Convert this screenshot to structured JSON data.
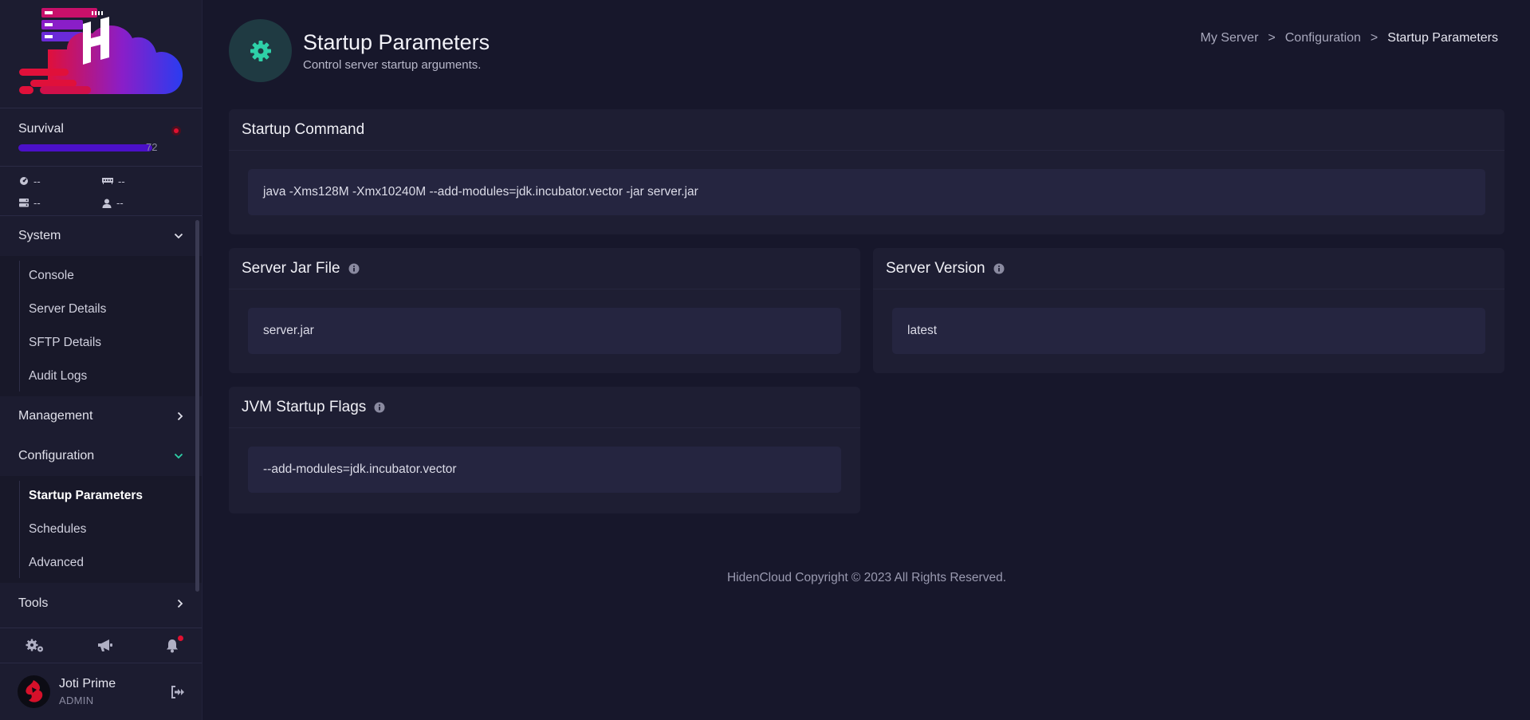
{
  "sidebar": {
    "server": {
      "name": "Survival",
      "id_suffix": "72"
    },
    "stats": {
      "cpu": "--",
      "memory": "--",
      "disk": "--",
      "players": "--"
    },
    "groups": [
      {
        "label": "System",
        "items": [
          "Console",
          "Server Details",
          "SFTP Details",
          "Audit Logs"
        ]
      },
      {
        "label": "Management"
      },
      {
        "label": "Configuration",
        "items": [
          "Startup Parameters",
          "Schedules",
          "Advanced"
        ]
      },
      {
        "label": "Tools"
      }
    ],
    "user": {
      "name": "Joti Prime",
      "role": "ADMIN"
    }
  },
  "header": {
    "title": "Startup Parameters",
    "subtitle": "Control server startup arguments."
  },
  "breadcrumb": [
    "My Server",
    "Configuration",
    "Startup Parameters"
  ],
  "breadcrumb_sep": ">",
  "cards": {
    "startup_command": {
      "title": "Startup Command",
      "value": "java -Xms128M -Xmx10240M --add-modules=jdk.incubator.vector -jar server.jar"
    },
    "server_jar": {
      "title": "Server Jar File",
      "value": "server.jar"
    },
    "server_version": {
      "title": "Server Version",
      "value": "latest"
    },
    "jvm_flags": {
      "title": "JVM Startup Flags",
      "value": "--add-modules=jdk.incubator.vector"
    }
  },
  "footer": "HidenCloud Copyright © 2023 All Rights Reserved.",
  "colors": {
    "accent": "#2ed1a8",
    "status_offline": "#e01030",
    "background": "#17172b",
    "card": "#1e1e33"
  }
}
